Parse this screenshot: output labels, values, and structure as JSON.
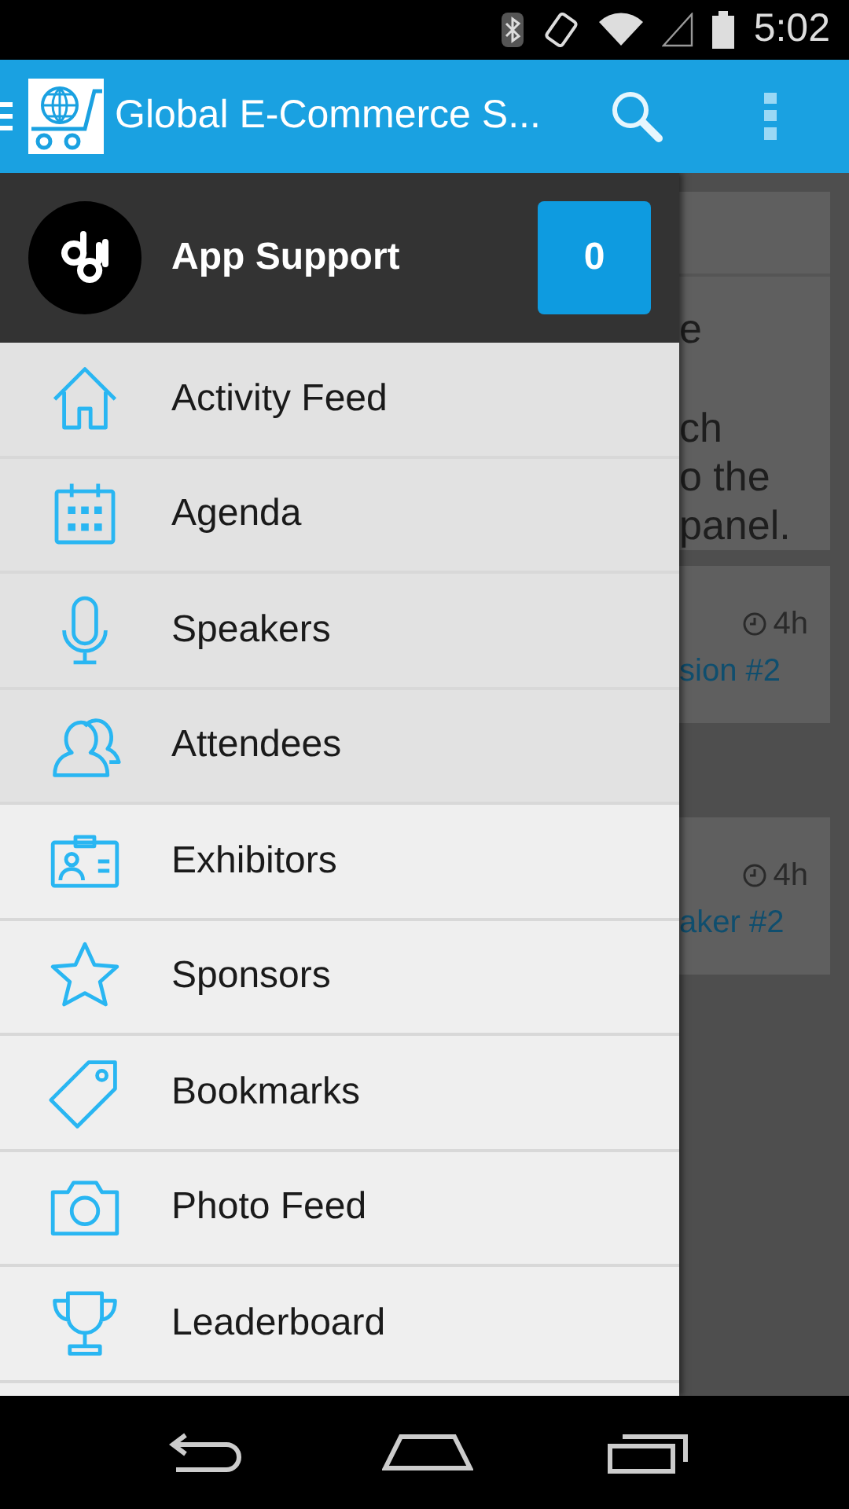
{
  "status_bar": {
    "time": "5:02"
  },
  "app_bar": {
    "title": "Global E-Commerce S..."
  },
  "drawer": {
    "header": {
      "name": "App Support",
      "count": "0"
    },
    "items": [
      {
        "label": "Activity Feed",
        "highlighted": true
      },
      {
        "label": "Agenda",
        "highlighted": true
      },
      {
        "label": "Speakers",
        "highlighted": true
      },
      {
        "label": "Attendees",
        "highlighted": true
      },
      {
        "label": "Exhibitors",
        "highlighted": false
      },
      {
        "label": "Sponsors",
        "highlighted": false
      },
      {
        "label": "Bookmarks",
        "highlighted": false
      },
      {
        "label": "Photo Feed",
        "highlighted": false
      },
      {
        "label": "Leaderboard",
        "highlighted": false
      }
    ]
  },
  "feed": {
    "post_text": [
      "e",
      "ch",
      "o the",
      "panel."
    ],
    "cards": [
      {
        "time": "4h",
        "link": "sion #2"
      },
      {
        "time": "4h",
        "link": "aker #2"
      }
    ]
  }
}
